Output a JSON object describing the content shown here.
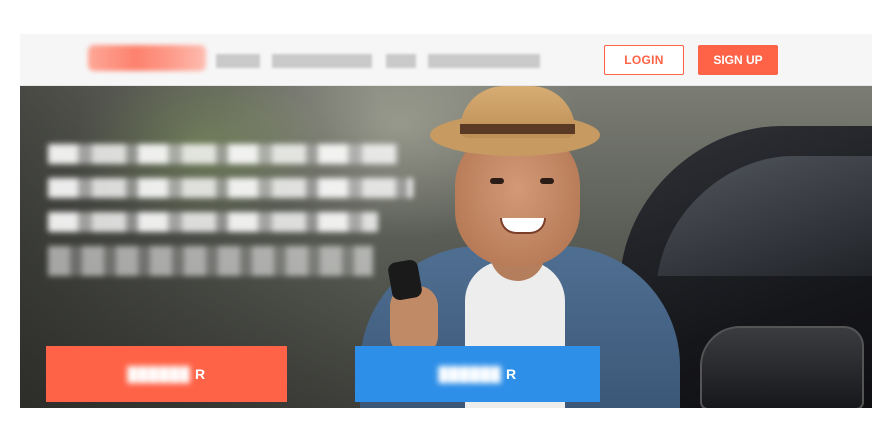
{
  "navbar": {
    "logo_text": "",
    "links": [
      "",
      "",
      "",
      ""
    ],
    "login_label": "LOGIN",
    "signup_label": "SIGN UP"
  },
  "hero": {
    "headline_lines": [
      "",
      "",
      ""
    ],
    "subtext": "",
    "cta_primary_label": "R",
    "cta_secondary_label": "R"
  },
  "colors": {
    "accent": "#ff6347",
    "secondary": "#2e8fe8",
    "nav_bg": "#f6f6f6"
  }
}
